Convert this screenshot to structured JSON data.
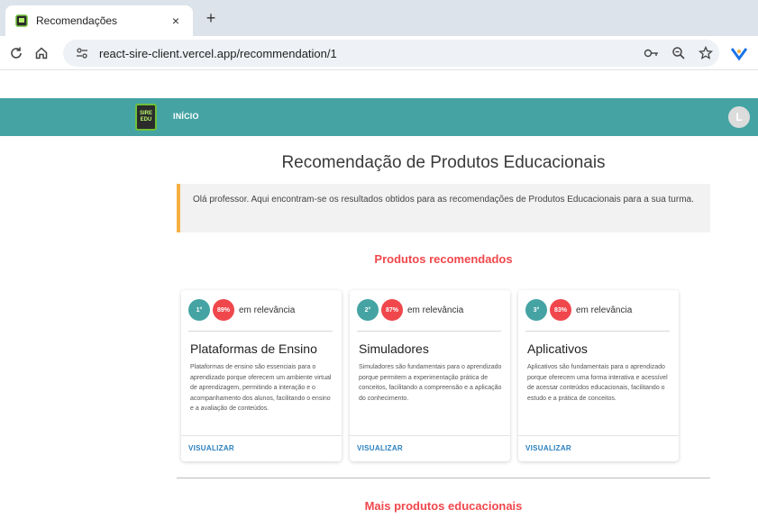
{
  "browser": {
    "tab_title": "Recomendações",
    "tab_close": "×",
    "new_tab": "+",
    "url": "react-sire-client.vercel.app/recommendation/1"
  },
  "app": {
    "logo_text": "SIRE EDU",
    "nav_inicio": "INÍCIO",
    "avatar_letter": "L",
    "brand_color": "#45a3a3",
    "accent_color": "#f0474c"
  },
  "page": {
    "title": "Recomendação de Produtos Educacionais",
    "info": "Olá professor. Aqui encontram-se os resultados obtidos para as recomendações de Produtos Educacionais para a sua turma.",
    "section_recommended": "Produtos recomendados",
    "section_more": "Mais produtos educacionais"
  },
  "cards": [
    {
      "rank": "1°",
      "percent": "89%",
      "relevance": "em relevância",
      "title": "Plataformas de Ensino",
      "description": "Plataformas de ensino são essenciais para o aprendizado porque oferecem um ambiente virtual de aprendizagem, permitindo a interação e o acompanhamento dos alunos, facilitando o ensino e a avaliação de conteúdos.",
      "link": "VISUALIZAR"
    },
    {
      "rank": "2°",
      "percent": "87%",
      "relevance": "em relevância",
      "title": "Simuladores",
      "description": "Simuladores são fundamentais para o aprendizado porque permitem a experimentação prática de conceitos, facilitando a compreensão e a aplicação do conhecimento.",
      "link": "VISUALIZAR"
    },
    {
      "rank": "3°",
      "percent": "83%",
      "relevance": "em relevância",
      "title": "Aplicativos",
      "description": "Aplicativos são fundamentais para o aprendizado porque oferecem uma forma interativa e acessível de acessar conteúdos educacionais, facilitando o estudo e a prática de conceitos.",
      "link": "VISUALIZAR"
    }
  ]
}
